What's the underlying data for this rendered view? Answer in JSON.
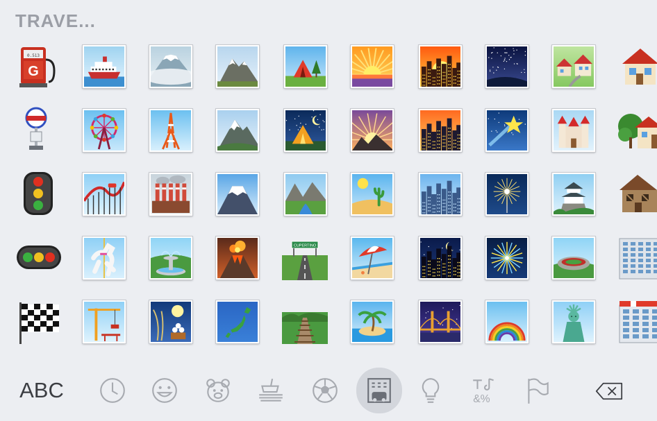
{
  "section_title": "TRAVE...",
  "grid": [
    [
      "fuel-pump",
      "ship",
      "mount-fuji-fog",
      "mountain",
      "tent",
      "sunrise",
      "city-sunset",
      "night-sky",
      "houses",
      "house"
    ],
    [
      "bus-stop",
      "ferris-wheel",
      "tokyo-tower",
      "snow-mountain",
      "camping-night",
      "sunrise-over-mountains",
      "cityscape-dusk",
      "shooting-star",
      "european-castle",
      "house-with-garden"
    ],
    [
      "traffic-light-vertical",
      "roller-coaster",
      "factory",
      "mount-fuji",
      "national-park",
      "desert",
      "cityscape",
      "sparkler",
      "japanese-castle",
      "derelict-house"
    ],
    [
      "traffic-light-horizontal",
      "carousel-horse",
      "fountain",
      "volcano",
      "motorway",
      "beach-umbrella",
      "night-with-stars",
      "fireworks",
      "stadium",
      "office-building"
    ],
    [
      "checkered-flag",
      "construction-crane",
      "moon-viewing",
      "map-of-japan",
      "railway-track",
      "desert-island",
      "bridge-at-night",
      "rainbow",
      "statue-of-liberty",
      "department-store"
    ]
  ],
  "sign_text": "CUPERTINO",
  "fuel_text": "G",
  "bottom_bar": {
    "abc_label": "ABC",
    "categories": [
      "recent",
      "smileys",
      "animals",
      "food",
      "activity",
      "travel",
      "objects",
      "symbols",
      "flags"
    ],
    "selected": "travel",
    "delete": "delete"
  },
  "colors": {
    "background": "#eceef2",
    "selected_pill": "#d3d6dc",
    "icon_gray": "#a7aab0"
  }
}
